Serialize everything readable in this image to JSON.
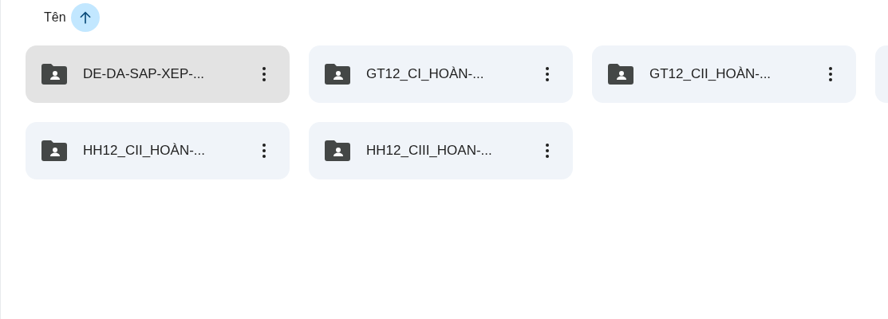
{
  "sort_header": {
    "label": "Tên",
    "ascending": true
  },
  "folders": [
    {
      "name": "DE-DA-SAP-XEP-...",
      "selected": true
    },
    {
      "name": "GT12_CI_HOÀN-...",
      "selected": false
    },
    {
      "name": "GT12_CII_HOÀN-...",
      "selected": false
    },
    {
      "name": "HH12_CII_HOÀN-...",
      "selected": false
    },
    {
      "name": "HH12_CIII_HOAN-...",
      "selected": false
    }
  ]
}
